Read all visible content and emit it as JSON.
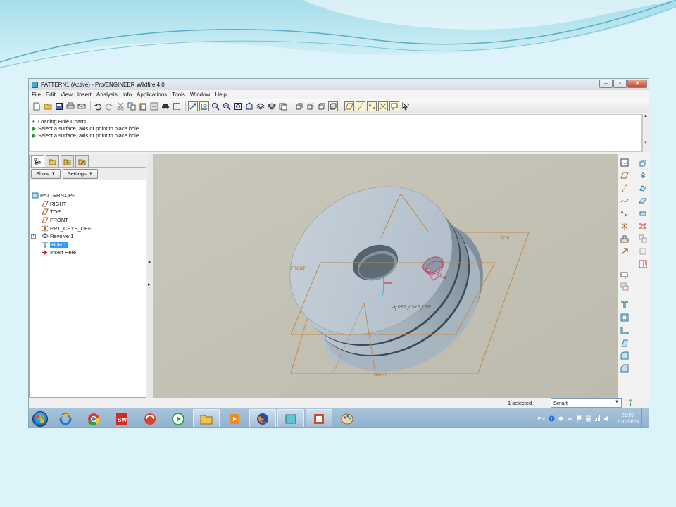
{
  "window": {
    "title": "PATTERN1 (Active) - Pro/ENGINEER Wildfire 4.0",
    "minimize": "–",
    "maximize": "▫",
    "close": "✕"
  },
  "menu": [
    "File",
    "Edit",
    "View",
    "Insert",
    "Analysis",
    "Info",
    "Applications",
    "Tools",
    "Window",
    "Help"
  ],
  "toolbar_icons": [
    "new-icon",
    "open-icon",
    "save-icon",
    "print-icon",
    "send-mail-icon",
    "undo-icon",
    "redo-icon",
    "cut-icon",
    "copy-icon",
    "paste-icon",
    "regenerate-icon",
    "find-icon",
    "select-box-icon",
    "spin-icon",
    "zoom-in-icon",
    "zoom-out-icon",
    "refit-icon",
    "reorient-icon",
    "saved-views-icon",
    "layers-icon",
    "shading-icon",
    "hidden-line-icon",
    "wireframe-icon",
    "datum-planes-icon",
    "datum-axes-icon",
    "datum-points-icon",
    "csys-icon",
    "whats-this-icon"
  ],
  "messages": {
    "line1": "Loading Hole Charts ...",
    "line2": "Select a surface, axis or point to place hole.",
    "line3": "Select a surface, axis or point to place hole."
  },
  "nav": {
    "show_label": "Show",
    "settings_label": "Settings",
    "tree": {
      "root": "PATTERN1.PRT",
      "right": "RIGHT",
      "top": "TOP",
      "front": "FRONT",
      "csys": "PRT_CSYS_DEF",
      "revolve": "Revolve 1",
      "hole": "Hole 1",
      "insert": "Insert Here"
    }
  },
  "viewport": {
    "label_front": "FRONT",
    "label_top": "TOP",
    "label_right": "RIGHT",
    "label_csys": "PRT_CSYS_DEF",
    "label_hole": "H2"
  },
  "status": {
    "selected": "1 selected",
    "filter": "Smart"
  },
  "taskbar": {
    "lang": "EN",
    "time": "21:59",
    "date": "2010/9/25"
  },
  "colors": {
    "model": "#bcc8d3",
    "datum": "#c08a4a",
    "hole_highlight": "#d8335a",
    "selection": "#3399ff"
  }
}
